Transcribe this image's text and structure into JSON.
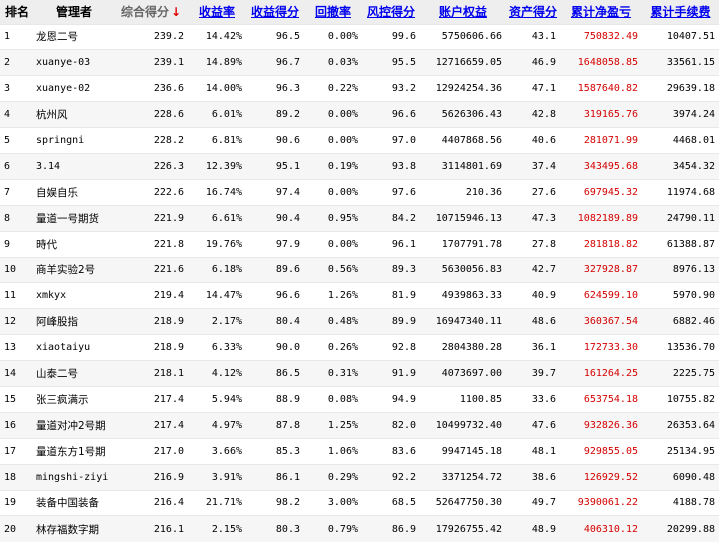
{
  "columns": [
    "排名",
    "管理者",
    "综合得分",
    "收益率",
    "收益得分",
    "回撤率",
    "风控得分",
    "账户权益",
    "资产得分",
    "累计净盈亏",
    "累计手续费"
  ],
  "sort_arrow": "↓",
  "colors": {
    "profit": "#d40000",
    "link_header": "#0000ee"
  },
  "rows": [
    {
      "rank": "1",
      "manager": "龙恩二号",
      "score": "239.2",
      "return": "14.42%",
      "return_score": "96.5",
      "drawdown": "0.00%",
      "risk_score": "99.6",
      "equity": "5750606.66",
      "asset_score": "43.1",
      "net_pnl": "750832.49",
      "fees": "10407.51"
    },
    {
      "rank": "2",
      "manager": "xuanye-03",
      "score": "239.1",
      "return": "14.89%",
      "return_score": "96.7",
      "drawdown": "0.03%",
      "risk_score": "95.5",
      "equity": "12716659.05",
      "asset_score": "46.9",
      "net_pnl": "1648058.85",
      "fees": "33561.15"
    },
    {
      "rank": "3",
      "manager": "xuanye-02",
      "score": "236.6",
      "return": "14.00%",
      "return_score": "96.3",
      "drawdown": "0.22%",
      "risk_score": "93.2",
      "equity": "12924254.36",
      "asset_score": "47.1",
      "net_pnl": "1587640.82",
      "fees": "29639.18"
    },
    {
      "rank": "4",
      "manager": "杭州风",
      "score": "228.6",
      "return": "6.01%",
      "return_score": "89.2",
      "drawdown": "0.00%",
      "risk_score": "96.6",
      "equity": "5626306.43",
      "asset_score": "42.8",
      "net_pnl": "319165.76",
      "fees": "3974.24"
    },
    {
      "rank": "5",
      "manager": "springni",
      "score": "228.2",
      "return": "6.81%",
      "return_score": "90.6",
      "drawdown": "0.00%",
      "risk_score": "97.0",
      "equity": "4407868.56",
      "asset_score": "40.6",
      "net_pnl": "281071.99",
      "fees": "4468.01"
    },
    {
      "rank": "6",
      "manager": "3.14",
      "score": "226.3",
      "return": "12.39%",
      "return_score": "95.1",
      "drawdown": "0.19%",
      "risk_score": "93.8",
      "equity": "3114801.69",
      "asset_score": "37.4",
      "net_pnl": "343495.68",
      "fees": "3454.32"
    },
    {
      "rank": "7",
      "manager": "自娱自乐",
      "score": "222.6",
      "return": "16.74%",
      "return_score": "97.4",
      "drawdown": "0.00%",
      "risk_score": "97.6",
      "equity": "210.36",
      "asset_score": "27.6",
      "net_pnl": "697945.32",
      "fees": "11974.68"
    },
    {
      "rank": "8",
      "manager": "量道一号期货",
      "score": "221.9",
      "return": "6.61%",
      "return_score": "90.4",
      "drawdown": "0.95%",
      "risk_score": "84.2",
      "equity": "10715946.13",
      "asset_score": "47.3",
      "net_pnl": "1082189.89",
      "fees": "24790.11"
    },
    {
      "rank": "9",
      "manager": "時代",
      "score": "221.8",
      "return": "19.76%",
      "return_score": "97.9",
      "drawdown": "0.00%",
      "risk_score": "96.1",
      "equity": "1707791.78",
      "asset_score": "27.8",
      "net_pnl": "281818.82",
      "fees": "61388.87"
    },
    {
      "rank": "10",
      "manager": "商羊实验2号",
      "score": "221.6",
      "return": "6.18%",
      "return_score": "89.6",
      "drawdown": "0.56%",
      "risk_score": "89.3",
      "equity": "5630056.83",
      "asset_score": "42.7",
      "net_pnl": "327928.87",
      "fees": "8976.13"
    },
    {
      "rank": "11",
      "manager": "xmkyx",
      "score": "219.4",
      "return": "14.47%",
      "return_score": "96.6",
      "drawdown": "1.26%",
      "risk_score": "81.9",
      "equity": "4939863.33",
      "asset_score": "40.9",
      "net_pnl": "624599.10",
      "fees": "5970.90"
    },
    {
      "rank": "12",
      "manager": "阿峰股指",
      "score": "218.9",
      "return": "2.17%",
      "return_score": "80.4",
      "drawdown": "0.48%",
      "risk_score": "89.9",
      "equity": "16947340.11",
      "asset_score": "48.6",
      "net_pnl": "360367.54",
      "fees": "6882.46"
    },
    {
      "rank": "13",
      "manager": "xiaotaiyu",
      "score": "218.9",
      "return": "6.33%",
      "return_score": "90.0",
      "drawdown": "0.26%",
      "risk_score": "92.8",
      "equity": "2804380.28",
      "asset_score": "36.1",
      "net_pnl": "172733.30",
      "fees": "13536.70"
    },
    {
      "rank": "14",
      "manager": "山泰二号",
      "score": "218.1",
      "return": "4.12%",
      "return_score": "86.5",
      "drawdown": "0.31%",
      "risk_score": "91.9",
      "equity": "4073697.00",
      "asset_score": "39.7",
      "net_pnl": "161264.25",
      "fees": "2225.75"
    },
    {
      "rank": "15",
      "manager": "张三疯满示",
      "score": "217.4",
      "return": "5.94%",
      "return_score": "88.9",
      "drawdown": "0.08%",
      "risk_score": "94.9",
      "equity": "1100.85",
      "asset_score": "33.6",
      "net_pnl": "653754.18",
      "fees": "10755.82"
    },
    {
      "rank": "16",
      "manager": "量道对冲2号期",
      "score": "217.4",
      "return": "4.97%",
      "return_score": "87.8",
      "drawdown": "1.25%",
      "risk_score": "82.0",
      "equity": "10499732.40",
      "asset_score": "47.6",
      "net_pnl": "932826.36",
      "fees": "26353.64"
    },
    {
      "rank": "17",
      "manager": "量道东方1号期",
      "score": "217.0",
      "return": "3.66%",
      "return_score": "85.3",
      "drawdown": "1.06%",
      "risk_score": "83.6",
      "equity": "9947145.18",
      "asset_score": "48.1",
      "net_pnl": "929855.05",
      "fees": "25134.95"
    },
    {
      "rank": "18",
      "manager": "mingshi-ziyi",
      "score": "216.9",
      "return": "3.91%",
      "return_score": "86.1",
      "drawdown": "0.29%",
      "risk_score": "92.2",
      "equity": "3371254.72",
      "asset_score": "38.6",
      "net_pnl": "126929.52",
      "fees": "6090.48"
    },
    {
      "rank": "19",
      "manager": "装备中国装备",
      "score": "216.4",
      "return": "21.71%",
      "return_score": "98.2",
      "drawdown": "3.00%",
      "risk_score": "68.5",
      "equity": "52647750.30",
      "asset_score": "49.7",
      "net_pnl": "9390061.22",
      "fees": "4188.78"
    },
    {
      "rank": "20",
      "manager": "林存福数字期",
      "score": "216.1",
      "return": "2.15%",
      "return_score": "80.3",
      "drawdown": "0.79%",
      "risk_score": "86.9",
      "equity": "17926755.42",
      "asset_score": "48.9",
      "net_pnl": "406310.12",
      "fees": "20299.88"
    }
  ]
}
